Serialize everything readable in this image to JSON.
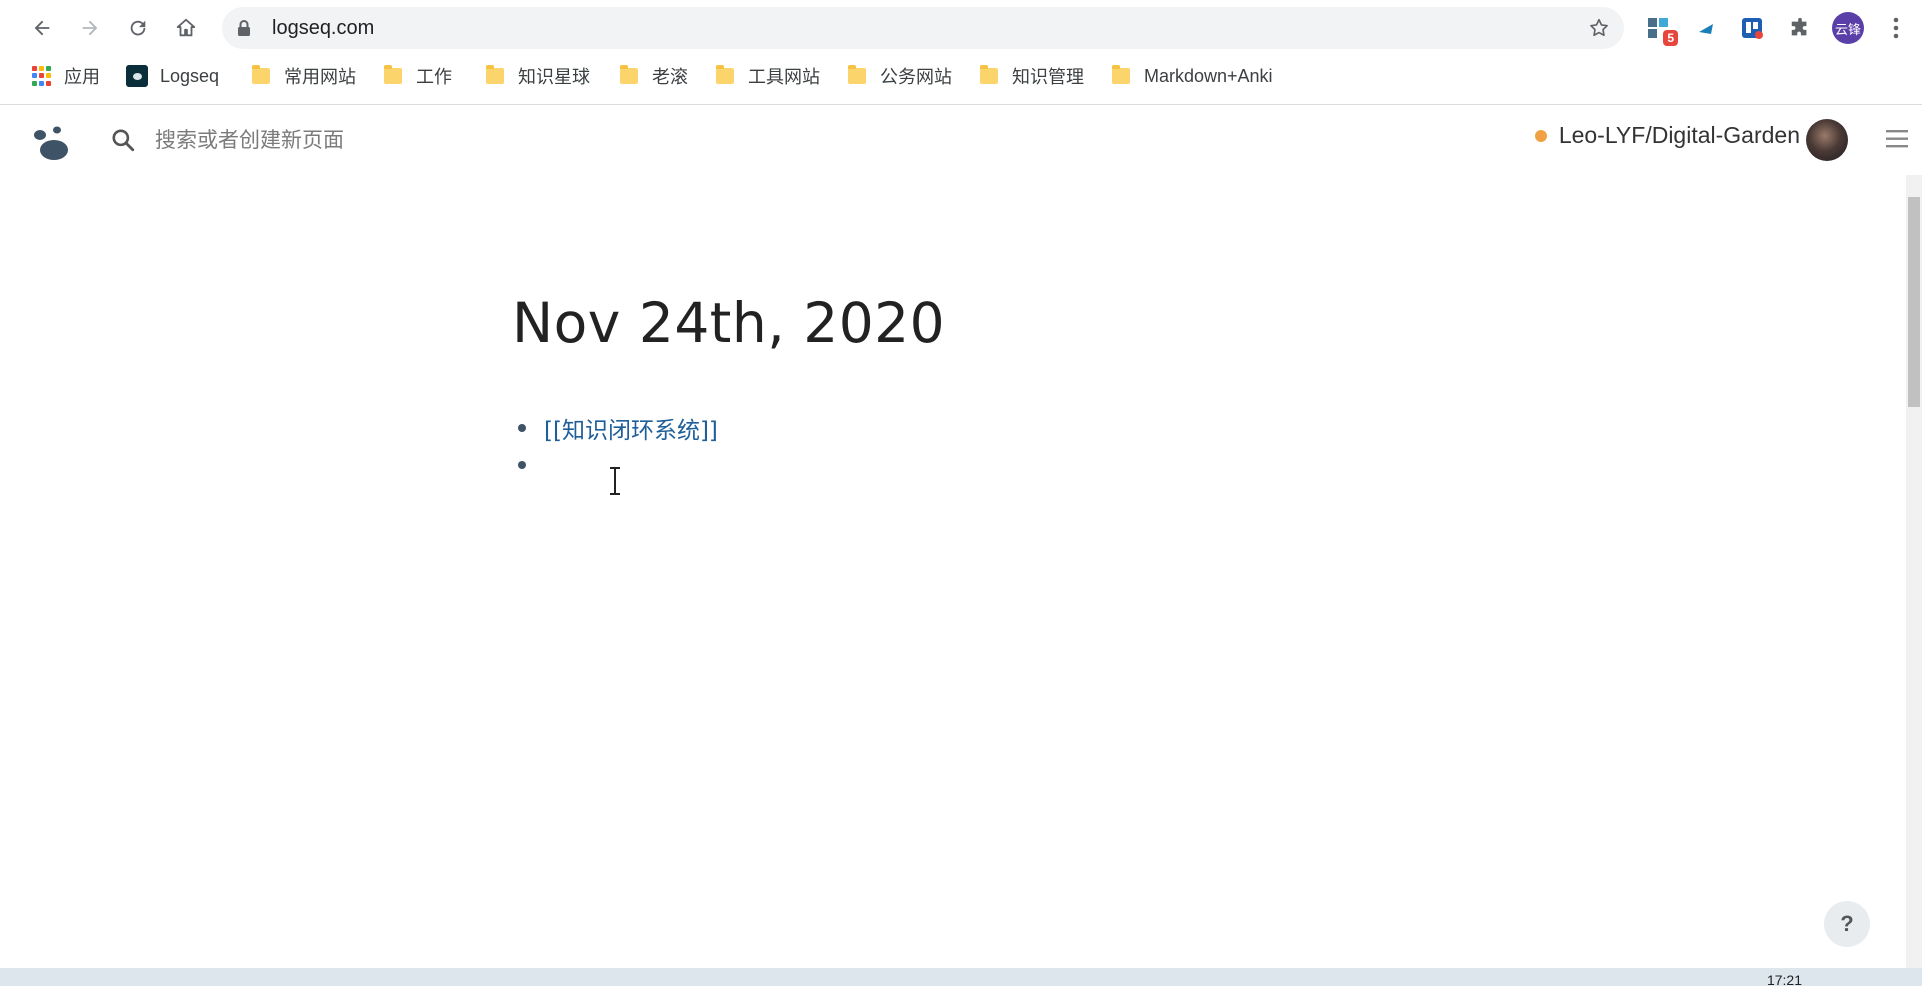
{
  "browser": {
    "url": "logseq.com",
    "extension_badge": "5",
    "profile_label": "云锋",
    "bookmarks": [
      {
        "label": "应用",
        "type": "apps"
      },
      {
        "label": "Logseq",
        "type": "site"
      },
      {
        "label": "常用网站",
        "type": "folder"
      },
      {
        "label": "工作",
        "type": "folder"
      },
      {
        "label": "知识星球",
        "type": "folder"
      },
      {
        "label": "老滚",
        "type": "folder"
      },
      {
        "label": "工具网站",
        "type": "folder"
      },
      {
        "label": "公务网站",
        "type": "folder"
      },
      {
        "label": "知识管理",
        "type": "folder"
      },
      {
        "label": "Markdown+Anki",
        "type": "folder"
      }
    ]
  },
  "app": {
    "search_placeholder": "搜索或者创建新页面",
    "repo_name": "Leo-LYF/Digital-Garden",
    "repo_status_color": "#f0a144",
    "page_title": "Nov 24th, 2020",
    "blocks": [
      {
        "text": "[[知识闭环系统]]"
      },
      {
        "text": ""
      }
    ],
    "help_label": "?"
  },
  "taskbar": {
    "time": "17:21"
  },
  "colors": {
    "link": "#1f5e99",
    "bullet": "#3f5366",
    "omnibox_bg": "#f1f3f4"
  }
}
